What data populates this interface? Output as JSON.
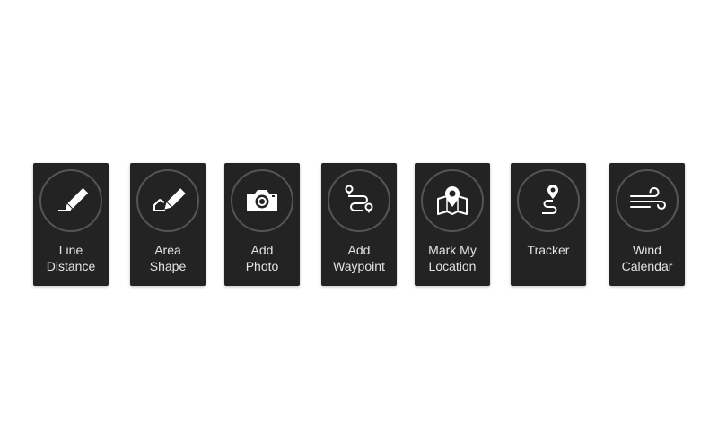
{
  "colors": {
    "background": "#ffffff",
    "card": "#232323",
    "ring": "#555555",
    "icon": "#ffffff",
    "text": "#e4e4e4"
  },
  "tools": [
    {
      "id": "line-distance",
      "icon": "pencil-line-icon",
      "label_line1": "Line",
      "label_line2": "Distance"
    },
    {
      "id": "area-shape",
      "icon": "pencil-area-icon",
      "label_line1": "Area",
      "label_line2": "Shape"
    },
    {
      "id": "add-photo",
      "icon": "camera-icon",
      "label_line1": "Add",
      "label_line2": "Photo"
    },
    {
      "id": "add-waypoint",
      "icon": "waypoint-route-icon",
      "label_line1": "Add",
      "label_line2": "Waypoint"
    },
    {
      "id": "mark-my-location",
      "icon": "map-pin-icon",
      "label_line1": "Mark My",
      "label_line2": "Location"
    },
    {
      "id": "tracker",
      "icon": "tracker-path-icon",
      "label_line1": "Tracker",
      "label_line2": ""
    },
    {
      "id": "wind-calendar",
      "icon": "wind-icon",
      "label_line1": "Wind",
      "label_line2": "Calendar"
    }
  ]
}
